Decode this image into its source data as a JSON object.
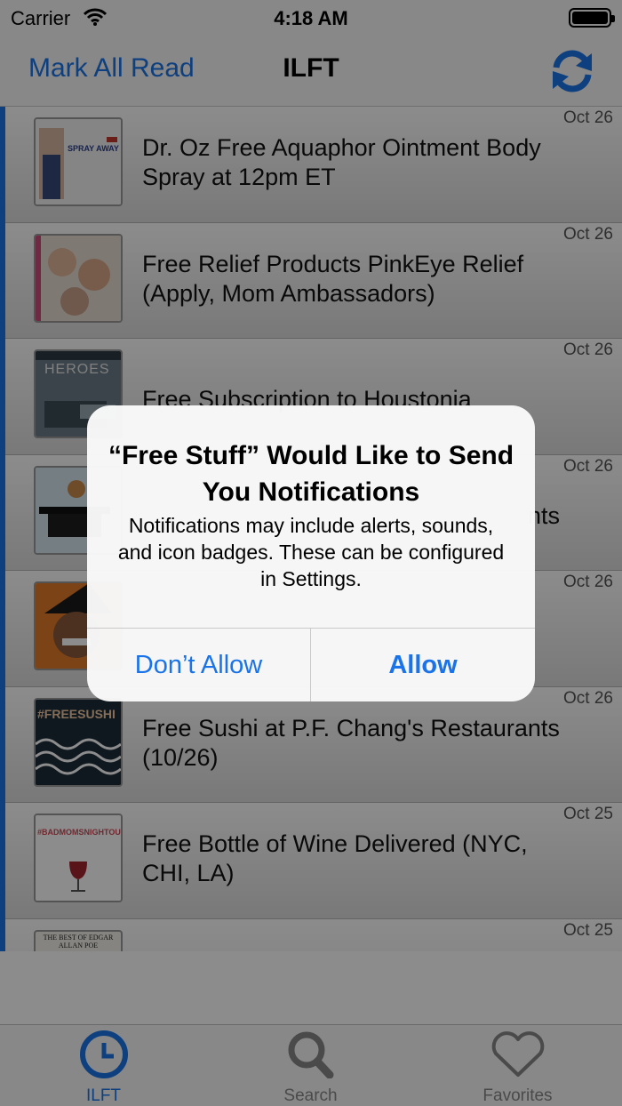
{
  "status": {
    "carrier": "Carrier",
    "time": "4:18 AM"
  },
  "nav": {
    "left_button": "Mark All Read",
    "title": "ILFT",
    "refresh_icon": "refresh-icon"
  },
  "rows": [
    {
      "date": "Oct 26",
      "title": "Dr. Oz Free Aquaphor Ointment Body Spray at 12pm ET",
      "thumb_text": "SPRAY AWAY"
    },
    {
      "date": "Oct 26",
      "title": "Free Relief Products PinkEye Relief (Apply, Mom Ambassadors)",
      "thumb_text": ""
    },
    {
      "date": "Oct 26",
      "title": "Free Subscription to Houstonia",
      "thumb_text": "HEROES"
    },
    {
      "date": "Oct 26",
      "title": "nts",
      "thumb_text": ""
    },
    {
      "date": "Oct 26",
      "title": "",
      "thumb_text": ""
    },
    {
      "date": "Oct 26",
      "title": "Free Sushi at P.F. Chang's Restaurants (10/26)",
      "thumb_text": "#FREESUSHI"
    },
    {
      "date": "Oct 25",
      "title": "Free Bottle of Wine Delivered (NYC, CHI, LA)",
      "thumb_text": "#BADMOMSNIGHTOU"
    },
    {
      "date": "Oct 25",
      "title": "",
      "thumb_text": "THE BEST OF EDGAR ALLAN POE"
    }
  ],
  "tabs": [
    {
      "label": "ILFT",
      "icon": "clock-icon",
      "active": true
    },
    {
      "label": "Search",
      "icon": "search-icon",
      "active": false
    },
    {
      "label": "Favorites",
      "icon": "heart-icon",
      "active": false
    }
  ],
  "alert": {
    "title": "“Free Stuff” Would Like to Send You Notifications",
    "message": "Notifications may include alerts, sounds, and icon badges. These can be configured in Settings.",
    "deny_label": "Don’t Allow",
    "allow_label": "Allow"
  },
  "colors": {
    "accent": "#1a73e8"
  }
}
